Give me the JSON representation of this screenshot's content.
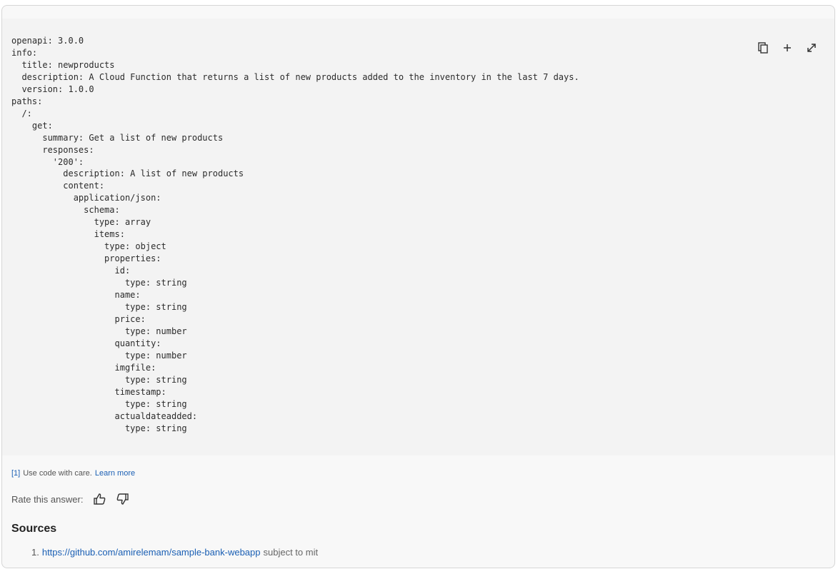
{
  "code": {
    "lines": [
      "openapi: 3.0.0",
      "info:",
      "  title: newproducts",
      "  description: A Cloud Function that returns a list of new products added to the inventory in the last 7 days.",
      "  version: 1.0.0",
      "paths:",
      "  /:",
      "    get:",
      "      summary: Get a list of new products",
      "      responses:",
      "        '200':",
      "          description: A list of new products",
      "          content:",
      "            application/json:",
      "              schema:",
      "                type: array",
      "                items:",
      "                  type: object",
      "                  properties:",
      "                    id:",
      "                      type: string",
      "                    name:",
      "                      type: string",
      "                    price:",
      "                      type: number",
      "                    quantity:",
      "                      type: number",
      "                    imgfile:",
      "                      type: string",
      "                    timestamp:",
      "                      type: string",
      "                    actualdateadded:",
      "                      type: string"
    ]
  },
  "toolbar": {
    "copy_icon": "copy-icon",
    "add_icon": "plus-icon",
    "expand_icon": "expand-icon"
  },
  "disclaimer": {
    "ref": "[1]",
    "text": "Use code with care.",
    "link": "Learn more"
  },
  "rating": {
    "label": "Rate this answer:",
    "up_icon": "thumbs-up-icon",
    "down_icon": "thumbs-down-icon"
  },
  "sources": {
    "title": "Sources",
    "items": [
      {
        "number": "1.",
        "url": "https://github.com/amirelemam/sample-bank-webapp",
        "note": "subject to mit"
      }
    ]
  },
  "colors": {
    "link": "#1a5fb4",
    "code_bg": "#f3f3f3",
    "card_bg": "#f8f8f8"
  }
}
